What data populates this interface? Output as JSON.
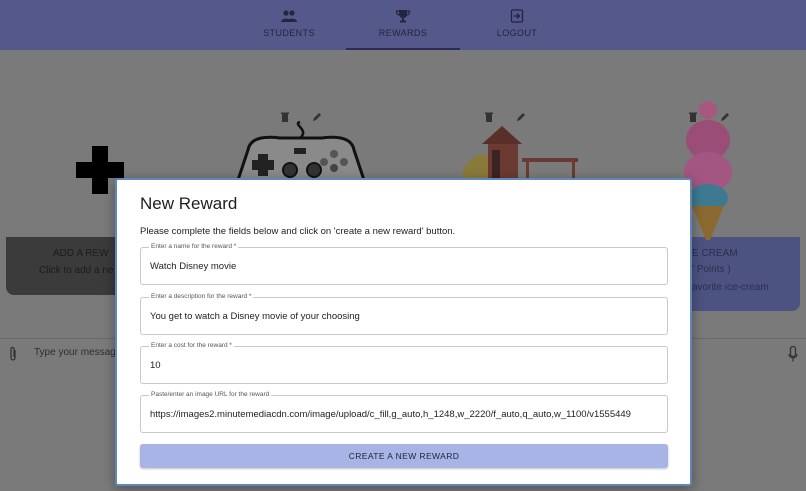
{
  "nav": {
    "items": [
      {
        "label": "STUDENTS",
        "icon": "people-icon"
      },
      {
        "label": "REWARDS",
        "icon": "trophy-icon"
      },
      {
        "label": "LOGOUT",
        "icon": "logout-icon"
      }
    ],
    "active": "REWARDS"
  },
  "background": {
    "add_card": {
      "title": "ADD A REW",
      "subtitle": "Click to add a ne"
    },
    "icecream_card": {
      "title": "E CREAM",
      "cost": "' Points )",
      "desc": "avorite ice-cream"
    },
    "chat": {
      "placeholder": "Type your messag"
    }
  },
  "modal": {
    "title": "New Reward",
    "instructions": "Please complete the fields below and click on 'create a new reward' button.",
    "fields": [
      {
        "label": "Enter a name for the reward *",
        "value": "Watch Disney movie"
      },
      {
        "label": "Enter a description for the reward *",
        "value": "You get to watch a Disney movie of your choosing"
      },
      {
        "label": "Enter a cost for the reward *",
        "value": "10"
      },
      {
        "label": "Paste/enter an image URL for the reward",
        "value": "https://images2.minutemediacdn.com/image/upload/c_fill,g_auto,h_1248,w_2220/f_auto,q_auto,w_1100/v1555449"
      }
    ],
    "submit_label": "CREATE A NEW REWARD"
  },
  "colors": {
    "nav_bg": "#54588a",
    "button_bg": "#a9b4e6",
    "modal_border": "#5f88b8"
  }
}
